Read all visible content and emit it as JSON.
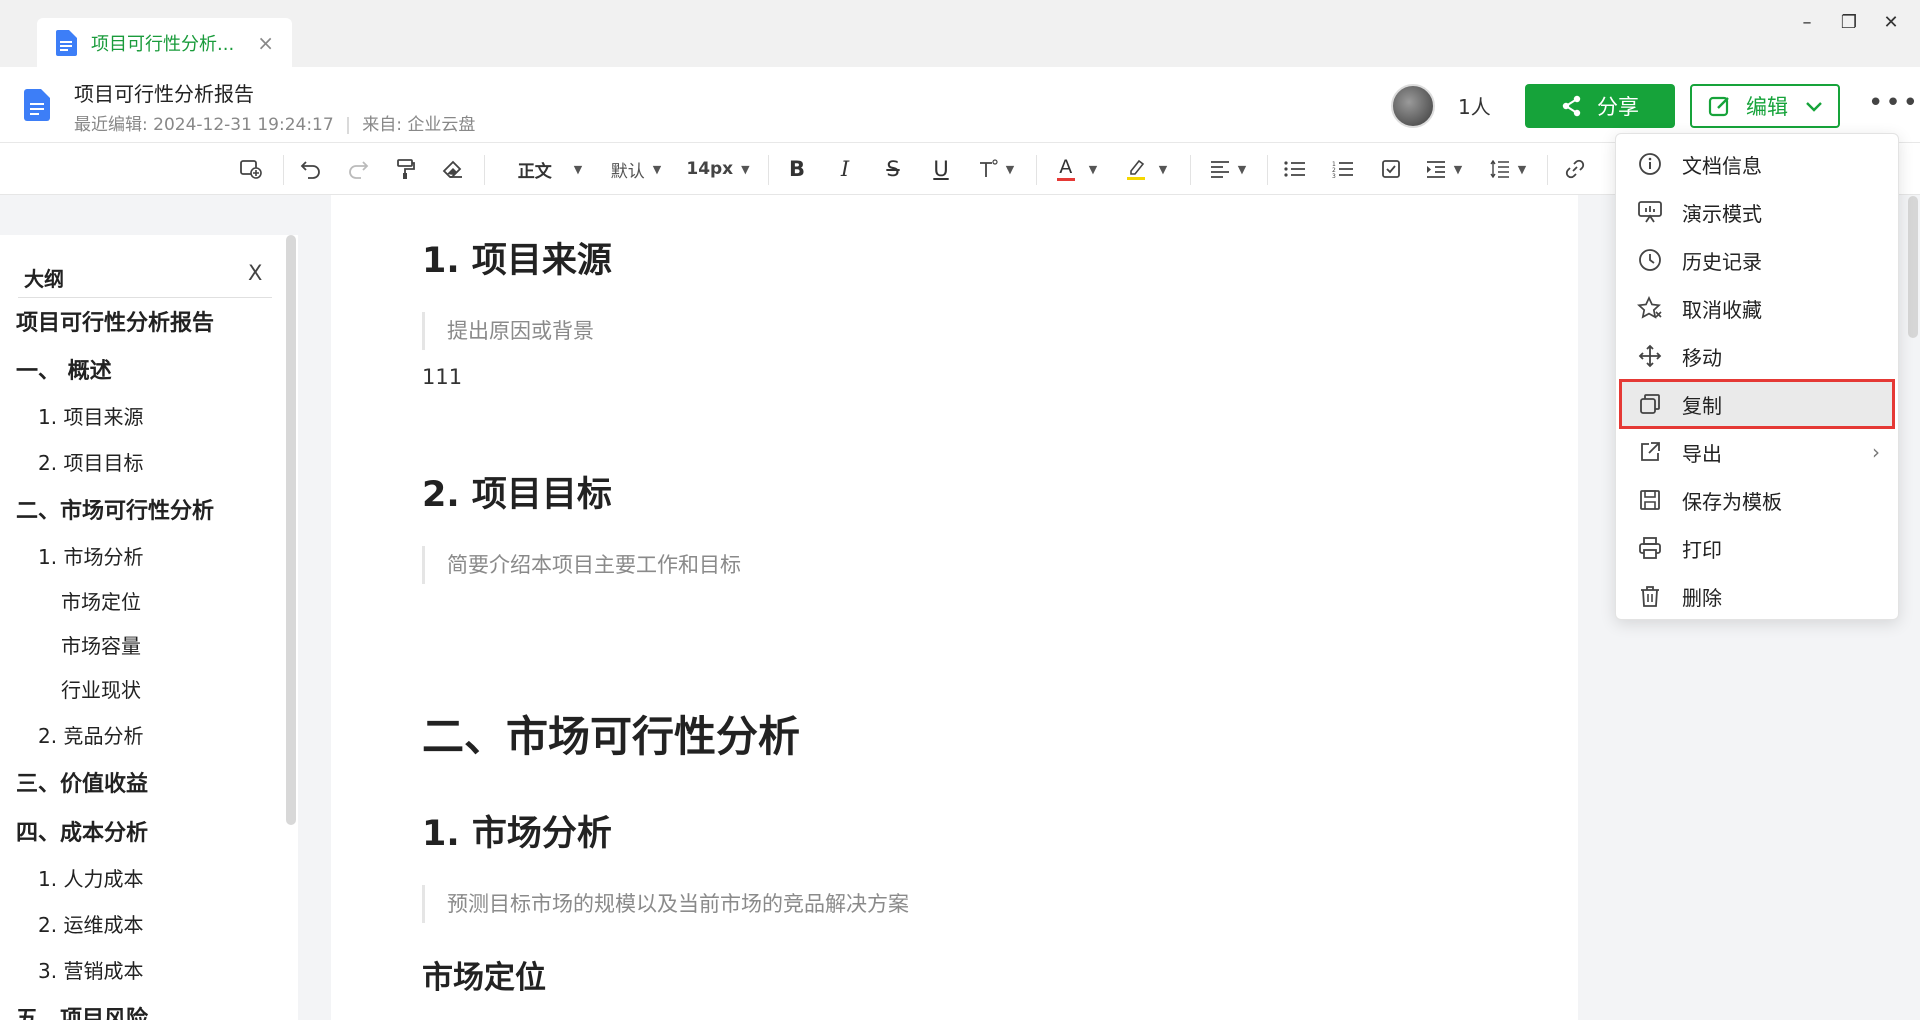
{
  "tab": {
    "title": "项目可行性分析...",
    "close": "×"
  },
  "window": {
    "minimize": "–",
    "restore": "❐",
    "close": "✕"
  },
  "header": {
    "title": "项目可行性分析报告",
    "last_edit_label": "最近编辑:",
    "last_edit_time": "2024-12-31 19:24:17",
    "source_label": "来自:",
    "source": "企业云盘",
    "people_count": "1人",
    "share_label": "分享",
    "edit_label": "编辑",
    "more": "•••"
  },
  "toolbar": {
    "style": "正文",
    "font": "默认",
    "size": "14px",
    "bold": "B",
    "italic": "I",
    "strike": "S",
    "underline": "U",
    "font_color_glyph": "A"
  },
  "outline": {
    "title": "大纲",
    "close": "X",
    "items": [
      {
        "label": "项目可行性分析报告",
        "level": 0
      },
      {
        "label": "一、 概述",
        "level": 1
      },
      {
        "label": "1. 项目来源",
        "level": 2
      },
      {
        "label": "2. 项目目标",
        "level": 2
      },
      {
        "label": "二、市场可行性分析",
        "level": 1
      },
      {
        "label": "1. 市场分析",
        "level": 2
      },
      {
        "label": "市场定位",
        "level": 3
      },
      {
        "label": "市场容量",
        "level": 3
      },
      {
        "label": "行业现状",
        "level": 3
      },
      {
        "label": "2. 竞品分析",
        "level": 2
      },
      {
        "label": "三、价值收益",
        "level": 1
      },
      {
        "label": "四、成本分析",
        "level": 1
      },
      {
        "label": "1. 人力成本",
        "level": 2
      },
      {
        "label": "2. 运维成本",
        "level": 2
      },
      {
        "label": "3. 营销成本",
        "level": 2
      },
      {
        "label": "五、项目风险",
        "level": 1
      }
    ]
  },
  "document": {
    "h_source": "1. 项目来源",
    "q_source": "提出原因或背景",
    "p_source": "111",
    "h_goal": "2. 项目目标",
    "q_goal": "简要介绍本项目主要工作和目标",
    "h_market": "二、市场可行性分析",
    "h_market_analysis": "1. 市场分析",
    "q_market_analysis": "预测目标市场的规模以及当前市场的竞品解决方案",
    "h_positioning": "市场定位"
  },
  "menu": {
    "items": [
      {
        "label": "文档信息",
        "icon": "info-icon"
      },
      {
        "label": "演示模式",
        "icon": "presentation-icon"
      },
      {
        "label": "历史记录",
        "icon": "clock-icon"
      },
      {
        "label": "取消收藏",
        "icon": "star-icon"
      },
      {
        "label": "移动",
        "icon": "move-icon"
      },
      {
        "label": "复制",
        "icon": "copy-icon"
      },
      {
        "label": "导出",
        "icon": "export-icon"
      },
      {
        "label": "保存为模板",
        "icon": "save-icon"
      },
      {
        "label": "打印",
        "icon": "print-icon"
      },
      {
        "label": "删除",
        "icon": "trash-icon"
      }
    ],
    "selected_index": 5
  },
  "colors": {
    "brand_green": "#16a33a",
    "tab_title_green": "#1a9b3b",
    "selection_red": "#e53935",
    "font_color_bar": "#e53935",
    "highlight_bar": "#f5d700"
  }
}
